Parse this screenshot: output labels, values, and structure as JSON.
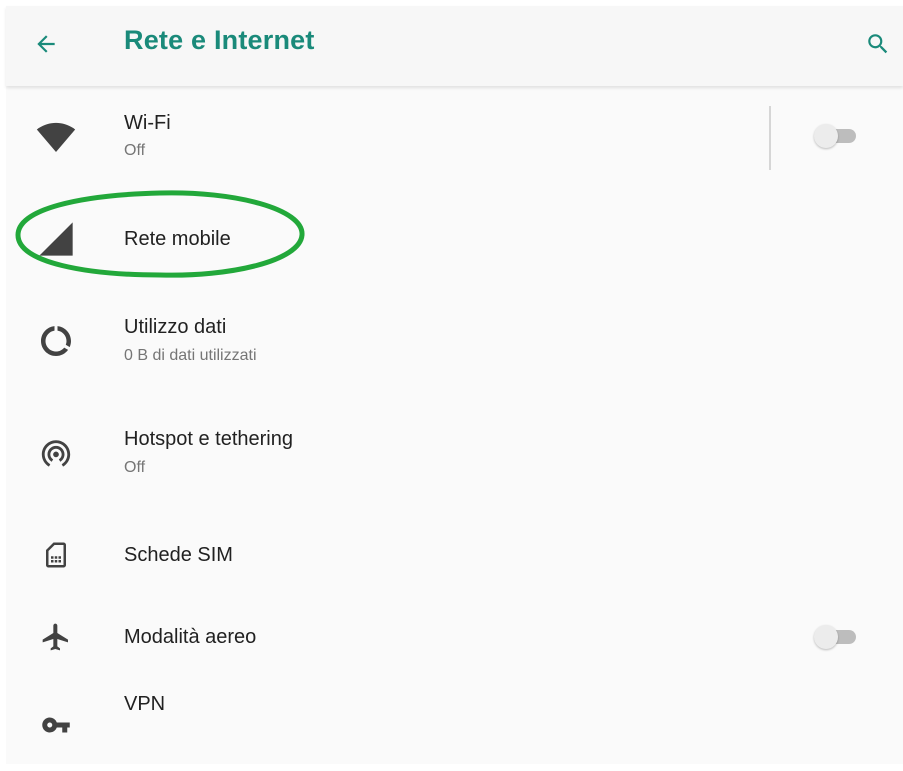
{
  "header": {
    "title": "Rete e Internet",
    "back_icon": "arrow-left-icon",
    "search_icon": "search-icon",
    "accent_color": "#1a8a7a"
  },
  "items": [
    {
      "id": "wifi",
      "title": "Wi-Fi",
      "summary": "Off",
      "icon": "wifi-icon",
      "toggle": "off"
    },
    {
      "id": "mobile",
      "title": "Rete mobile",
      "icon": "cellular-signal-icon"
    },
    {
      "id": "data",
      "title": "Utilizzo dati",
      "summary": "0 B di dati utilizzati",
      "icon": "data-usage-icon"
    },
    {
      "id": "hotspot",
      "title": "Hotspot e tethering",
      "summary": "Off",
      "icon": "hotspot-icon"
    },
    {
      "id": "sim",
      "title": "Schede SIM",
      "icon": "sim-card-icon"
    },
    {
      "id": "airplane",
      "title": "Modalità aereo",
      "icon": "airplane-icon",
      "toggle": "off"
    },
    {
      "id": "vpn",
      "title": "VPN",
      "icon": "vpn-key-icon"
    }
  ],
  "annotation": {
    "color": "#22a83a"
  }
}
